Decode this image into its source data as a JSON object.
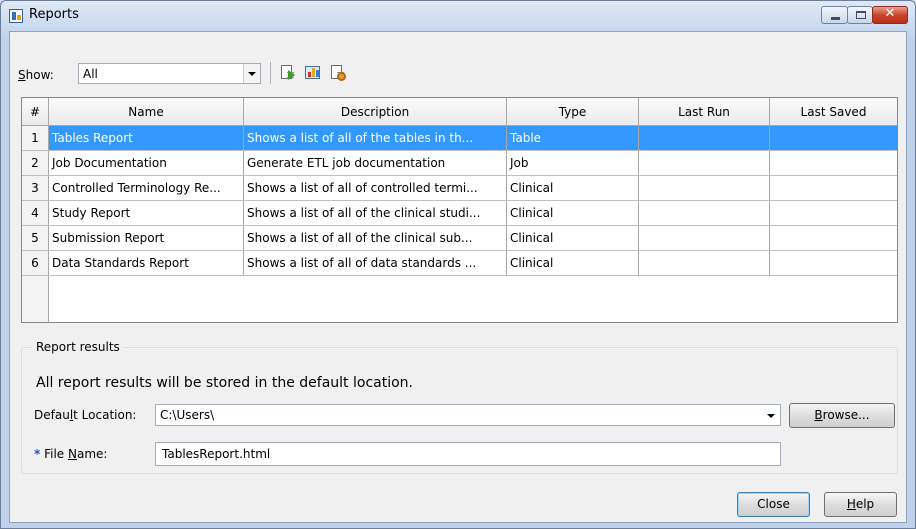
{
  "window": {
    "title": "Reports"
  },
  "toolbar": {
    "show_label_prefix": "S",
    "show_label_rest": "how:",
    "show_value": "All",
    "icons": [
      "run-report-icon",
      "view-report-icon",
      "report-properties-icon"
    ]
  },
  "table": {
    "columns": [
      "#",
      "Name",
      "Description",
      "Type",
      "Last Run",
      "Last Saved"
    ],
    "rows": [
      {
        "num": "1",
        "name": "Tables Report",
        "description": "Shows a list of all of the tables in th...",
        "type": "Table",
        "last_run": "",
        "last_saved": ""
      },
      {
        "num": "2",
        "name": "Job Documentation",
        "description": "Generate ETL job documentation",
        "type": "Job",
        "last_run": "",
        "last_saved": ""
      },
      {
        "num": "3",
        "name": "Controlled Terminology Re...",
        "description": "Shows a list of all of controlled termi...",
        "type": "Clinical",
        "last_run": "",
        "last_saved": ""
      },
      {
        "num": "4",
        "name": "Study Report",
        "description": "Shows a list of all of the clinical studi...",
        "type": "Clinical",
        "last_run": "",
        "last_saved": ""
      },
      {
        "num": "5",
        "name": "Submission Report",
        "description": "Shows a list of all of the clinical sub...",
        "type": "Clinical",
        "last_run": "",
        "last_saved": ""
      },
      {
        "num": "6",
        "name": "Data Standards Report",
        "description": "Shows a list of all of data standards ...",
        "type": "Clinical",
        "last_run": "",
        "last_saved": ""
      }
    ],
    "selected_row": 1
  },
  "results": {
    "group_title": "Report results",
    "info": "All report results will be stored in the default location.",
    "default_location_label_a": "Defau",
    "default_location_label_u": "l",
    "default_location_label_b": "t Location:",
    "default_location_value": "C:\\Users\\",
    "file_name_marker": "*",
    "file_name_label_a": " File ",
    "file_name_label_u": "N",
    "file_name_label_b": "ame:",
    "file_name_value": "TablesReport.html",
    "browse_u": "B",
    "browse_rest": "rowse..."
  },
  "footer": {
    "close_label": "Close",
    "help_u": "H",
    "help_rest": "elp"
  },
  "colors": {
    "selection": "#3399ff",
    "required_marker": "#1b58c4"
  }
}
